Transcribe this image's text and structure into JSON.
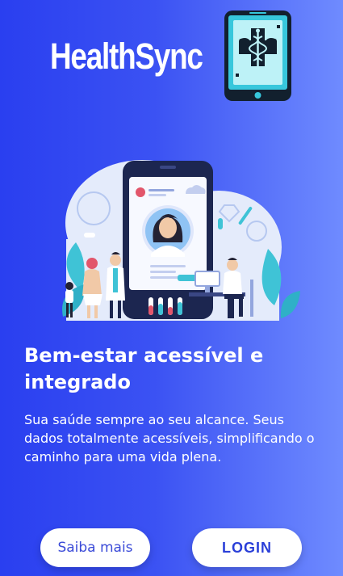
{
  "brand": {
    "name": "HealthSync",
    "logo_icon": "medical-tablet-caduceus-icon"
  },
  "colors": {
    "background_start": "#2a3ff0",
    "background_end": "#6f8bff",
    "button_text": "#2a3fd8"
  },
  "hero": {
    "headline": "Bem-estar acessível e integrado",
    "description": "Sua saúde sempre ao seu alcance. Seus dados totalmente acessíveis, simplificando o caminho para uma vida plena."
  },
  "actions": {
    "secondary_label": "Saiba mais",
    "primary_label": "LOGIN"
  }
}
